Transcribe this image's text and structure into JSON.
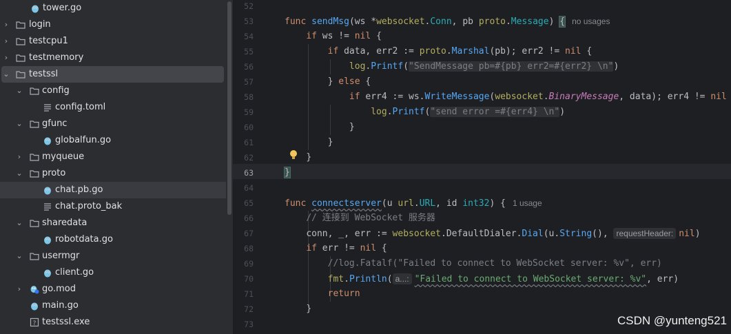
{
  "sidebar": {
    "items": [
      {
        "label": "tower.go",
        "kind": "go",
        "arrow": ""
      },
      {
        "label": "login",
        "kind": "folder",
        "arrow": "›"
      },
      {
        "label": "testcpu1",
        "kind": "folder",
        "arrow": "›"
      },
      {
        "label": "testmemory",
        "kind": "folder",
        "arrow": "›"
      },
      {
        "label": "testssl",
        "kind": "folder",
        "arrow": "⌄"
      },
      {
        "label": "config",
        "kind": "folder",
        "arrow": "⌄"
      },
      {
        "label": "config.toml",
        "kind": "text",
        "arrow": ""
      },
      {
        "label": "gfunc",
        "kind": "folder",
        "arrow": "⌄"
      },
      {
        "label": "globalfun.go",
        "kind": "go",
        "arrow": ""
      },
      {
        "label": "myqueue",
        "kind": "folder",
        "arrow": "›"
      },
      {
        "label": "proto",
        "kind": "folder",
        "arrow": "⌄"
      },
      {
        "label": "chat.pb.go",
        "kind": "go",
        "arrow": ""
      },
      {
        "label": "chat.proto_bak",
        "kind": "text",
        "arrow": ""
      },
      {
        "label": "sharedata",
        "kind": "folder",
        "arrow": "⌄"
      },
      {
        "label": "robotdata.go",
        "kind": "go",
        "arrow": ""
      },
      {
        "label": "usermgr",
        "kind": "folder",
        "arrow": "⌄"
      },
      {
        "label": "client.go",
        "kind": "go",
        "arrow": ""
      },
      {
        "label": "go.mod",
        "kind": "gomod",
        "arrow": "›"
      },
      {
        "label": "main.go",
        "kind": "go",
        "arrow": ""
      },
      {
        "label": "testssl.exe",
        "kind": "exe",
        "arrow": ""
      }
    ]
  },
  "editor": {
    "line_numbers": [
      "52",
      "53",
      "54",
      "55",
      "56",
      "57",
      "58",
      "59",
      "60",
      "61",
      "62",
      "63",
      "64",
      "65",
      "66",
      "67",
      "68",
      "69",
      "70",
      "71",
      "72",
      "73"
    ],
    "current_line": "63",
    "l53": {
      "kw": "func",
      "name": "sendMsg",
      "p1": "(ws *",
      "pkg": "websocket",
      "dot": ".",
      "t1": "Conn",
      "p2": ", pb ",
      "pkg2": "proto",
      "dot2": ".",
      "t2": "Message",
      "p3": ") ",
      "brace": "{",
      "usage": "no usages"
    },
    "l54": {
      "kw": "if",
      "rest": " ws != ",
      "nil": "nil",
      "end": " {"
    },
    "l55": {
      "kw": "if",
      "a": " data, err2 := ",
      "pkg": "proto",
      "dot": ".",
      "fn": "Marshal",
      "b": "(pb); err2 != ",
      "nil": "nil",
      "end": " {"
    },
    "l56": {
      "pkg": "log",
      "dot": ".",
      "fn": "Printf",
      "open": "(",
      "str": "\"SendMessage pb=#{pb} err2=#{err2} \\n\"",
      "close": ")"
    },
    "l57": {
      "a": "} ",
      "kw": "else",
      "b": " {"
    },
    "l58": {
      "kw": "if",
      "a": " err4 := ws.",
      "fn": "WriteMessage",
      "b": "(",
      "pkg": "websocket",
      "dot": ".",
      "c": "BinaryMessage",
      "d": ", data); err4 != ",
      "nil": "nil"
    },
    "l59": {
      "pkg": "log",
      "dot": ".",
      "fn": "Printf",
      "open": "(",
      "str": "\"send error =#{err4} \\n\"",
      "close": ")"
    },
    "l60": {
      "text": "}"
    },
    "l61": {
      "text": "}"
    },
    "l62": {
      "text": "}"
    },
    "l63": {
      "text": "}"
    },
    "l65": {
      "kw": "func",
      "name": "connectserver",
      "a": "(u ",
      "pkg": "url",
      "dot": ".",
      "t": "URL",
      "b": ", id ",
      "t2": "int32",
      "c": ") {",
      "usage": "1 usage"
    },
    "l66": {
      "text": "// 连接到 WebSocket 服务器"
    },
    "l67": {
      "a": "conn, _, err := ",
      "pkg": "websocket",
      "dot": ".",
      "b": "DefaultDialer.",
      "fn": "Dial",
      "c": "(u.",
      "fn2": "String",
      "d": "(), ",
      "hint": "requestHeader:",
      "nil": "nil",
      "e": ")"
    },
    "l68": {
      "kw": "if",
      "a": " err != ",
      "nil": "nil",
      "b": " {"
    },
    "l69": {
      "text": "//log.Fatalf(\"Failed to connect to WebSocket server: %v\", err)"
    },
    "l70": {
      "pkg": "fmt",
      "dot": ".",
      "fn": "Println",
      "open": "(",
      "hint": "a...:",
      "str": "\"Failed to connect to WebSocket server: %v\"",
      "b": ", err)"
    },
    "l71": {
      "kw": "return"
    },
    "l72": {
      "text": "}"
    }
  },
  "watermark": "CSDN @yunteng521",
  "colors": {
    "folder": "#a8adb5",
    "go_icon": "#7cc6e8",
    "bg": "#1e1f22",
    "sidebar_bg": "#2b2d30"
  }
}
